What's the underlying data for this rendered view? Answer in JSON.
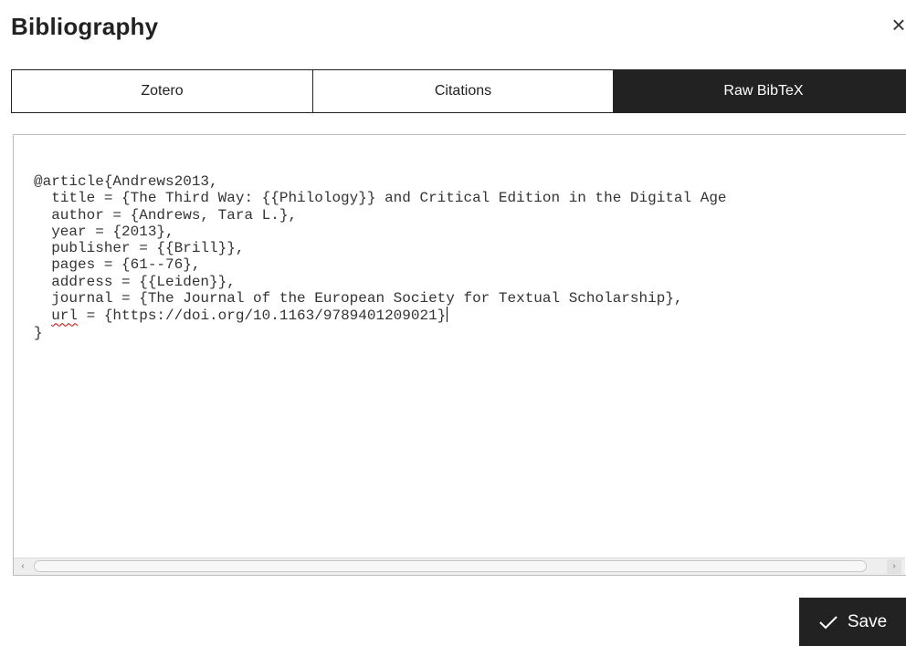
{
  "dialog": {
    "title": "Bibliography",
    "close_label": "×"
  },
  "tabs": [
    {
      "label": "Zotero",
      "active": false
    },
    {
      "label": "Citations",
      "active": false
    },
    {
      "label": "Raw BibTeX",
      "active": true
    }
  ],
  "editor": {
    "lines": [
      "@article{Andrews2013,",
      "  title = {The Third Way: {{Philology}} and Critical Edition in the Digital Age",
      "  author = {Andrews, Tara L.},",
      "  year = {2013},",
      "  publisher = {{Brill}},",
      "  pages = {61--76},",
      "  address = {{Leiden}},",
      "  journal = {The Journal of the European Society for Textual Scholarship},",
      "  url = {https://doi.org/10.1163/9789401209021}",
      "}"
    ],
    "url_indent": "  ",
    "url_key": "url",
    "url_rest": " = {https://doi.org/10.1163/9789401209021}",
    "scroll_left": "‹",
    "scroll_right": "›"
  },
  "footer": {
    "save_label": "Save",
    "save_icon": "check-icon"
  }
}
